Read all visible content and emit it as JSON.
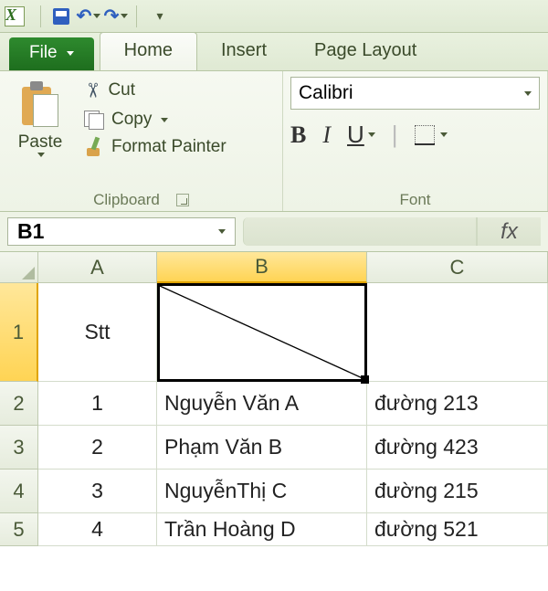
{
  "qat": {
    "undo": "↶",
    "redo": "↷"
  },
  "tabs": {
    "file": "File",
    "home": "Home",
    "insert": "Insert",
    "pageLayout": "Page Layout"
  },
  "ribbon": {
    "clipboard": {
      "title": "Clipboard",
      "paste": "Paste",
      "cut": "Cut",
      "copy": "Copy",
      "formatPainter": "Format Painter"
    },
    "font": {
      "title": "Font",
      "name": "Calibri",
      "bold": "B",
      "italic": "I",
      "underline": "U"
    }
  },
  "nameBox": "B1",
  "fxLabel": "fx",
  "columns": [
    "A",
    "B",
    "C"
  ],
  "rows": [
    {
      "n": "1",
      "a": "Stt",
      "b": "",
      "c": ""
    },
    {
      "n": "2",
      "a": "1",
      "b": "Nguyễn Văn A",
      "c": "đường 213"
    },
    {
      "n": "3",
      "a": "2",
      "b": "Phạm Văn B",
      "c": "đường 423"
    },
    {
      "n": "4",
      "a": "3",
      "b": "NguyễnThị C",
      "c": "đường 215"
    },
    {
      "n": "5",
      "a": "4",
      "b": "Trần Hoàng D",
      "c": "đường 521"
    }
  ]
}
